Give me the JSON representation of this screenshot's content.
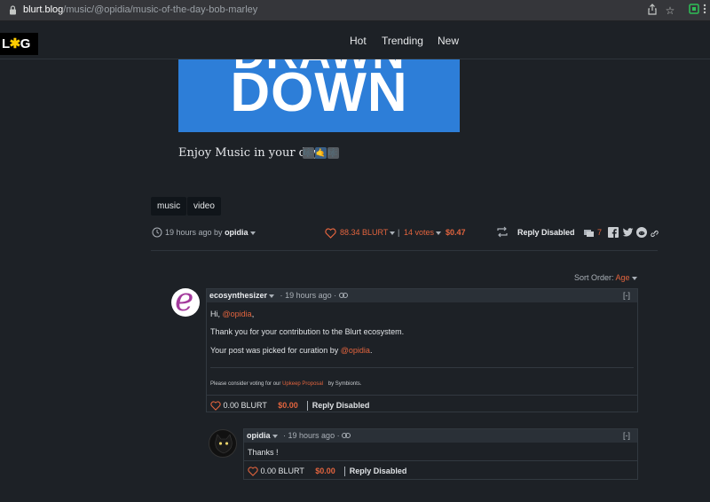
{
  "browser": {
    "url_domain": "blurt.blog",
    "url_path": "/music/@opidia/music-of-the-day-bob-marley",
    "share_icon": "share-icon",
    "bookmark_icon": "star-icon"
  },
  "header": {
    "logo_text_left": "L",
    "logo_star": "✱",
    "logo_text_right": "G",
    "nav": [
      "Hot",
      "Trending",
      "New"
    ]
  },
  "post": {
    "banner_top": "DRAWN",
    "banner_main": "DOWN",
    "intro": "Enjoy Music in your day",
    "emoji": [
      "🎼",
      "🤙",
      "🎼"
    ],
    "tags": [
      "music",
      "video"
    ],
    "time_prefix": "19 hours ago by",
    "author": "opidia",
    "payout": "88.34 BLURT",
    "votes": "14 votes",
    "value": "$0.47",
    "reply_disabled": "Reply Disabled",
    "comment_count": "7"
  },
  "sort": {
    "label": "Sort Order:",
    "value": "Age"
  },
  "comments": [
    {
      "author": "ecosynthesizer",
      "time": "19 hours ago",
      "collapse": "[-]",
      "greeting": "Hi,",
      "mention": "@opidia",
      "greeting_end": ",",
      "line1": "Thank you for your contribution to the Blurt ecosystem.",
      "line2_prefix": "Your post was picked for curation by",
      "line2_mention": "@opidia",
      "line2_end": ".",
      "small_prefix": "Please consider voting for our",
      "small_link": "Upkeep Proposal",
      "small_suffix": "by Symbionts.",
      "payout": "0.00 BLURT",
      "value": "$0.00",
      "reply": "Reply Disabled"
    },
    {
      "author": "opidia",
      "time": "19 hours ago",
      "collapse": "[-]",
      "text": "Thanks !",
      "payout": "0.00 BLURT",
      "value": "$0.00",
      "reply": "Reply Disabled"
    }
  ],
  "colors": {
    "accent": "#e2643e",
    "background": "#1d2126",
    "banner": "#2d7ed8"
  }
}
